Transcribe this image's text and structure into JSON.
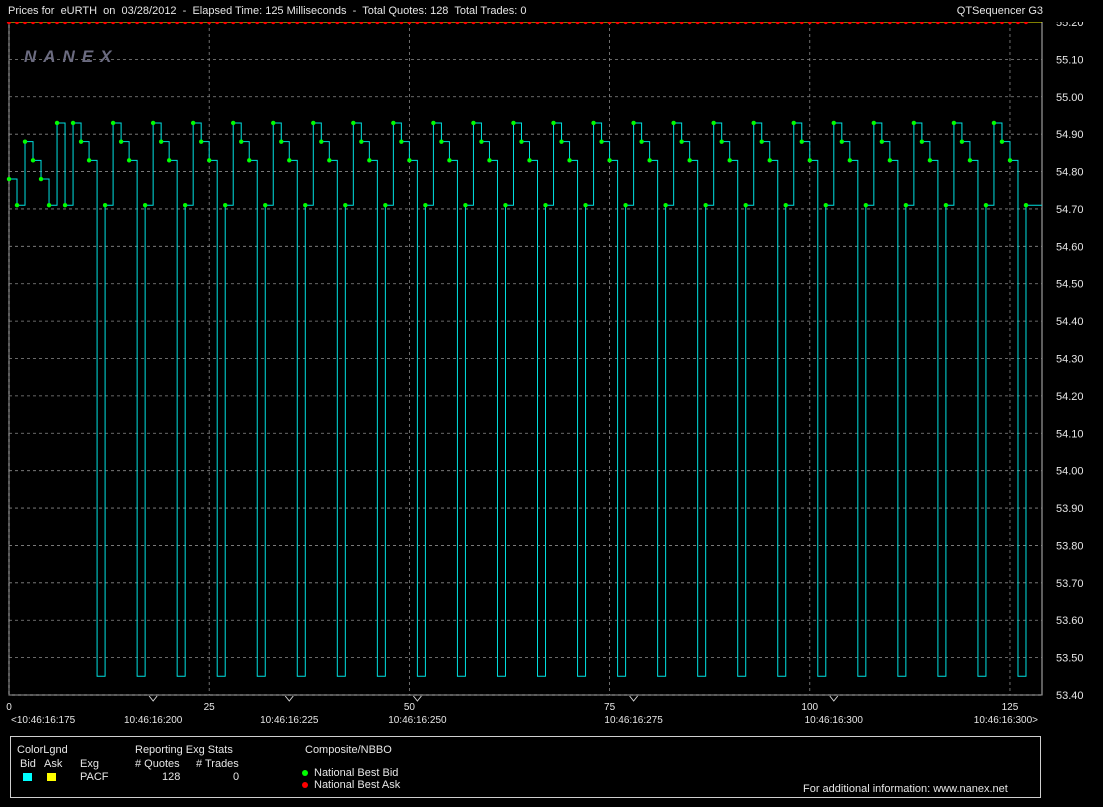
{
  "header": {
    "title": "Prices for  eURTH  on  03/28/2012  -  Elapsed Time: 125 Milliseconds  -  Total Quotes: 128  Total Trades: 0",
    "app_name": "QTSequencer G3"
  },
  "watermark": "NANEX",
  "chart_data": {
    "type": "line",
    "ylim": [
      53.4,
      55.2
    ],
    "yticks": [
      "55.20",
      "55.10",
      "55.00",
      "54.90",
      "54.80",
      "54.70",
      "54.60",
      "54.50",
      "54.40",
      "54.30",
      "54.20",
      "54.10",
      "54.00",
      "53.90",
      "53.80",
      "53.70",
      "53.60",
      "53.50",
      "53.40"
    ],
    "xlim": [
      0,
      129
    ],
    "xticks": [
      {
        "x": 0,
        "label": "0"
      },
      {
        "x": 25,
        "label": "25"
      },
      {
        "x": 50,
        "label": "50"
      },
      {
        "x": 75,
        "label": "75"
      },
      {
        "x": 100,
        "label": "100"
      },
      {
        "x": 125,
        "label": "125"
      }
    ],
    "time_labels": [
      {
        "x": 0,
        "label": "<10:46:16:175"
      },
      {
        "x": 18,
        "label": "10:46:16:200"
      },
      {
        "x": 35,
        "label": "10:46:16:225"
      },
      {
        "x": 51,
        "label": "10:46:16:250"
      },
      {
        "x": 78,
        "label": "10:46:16:275"
      },
      {
        "x": 103,
        "label": "10:46:16:300"
      },
      {
        "x": 129,
        "label": "10:46:16:300>"
      }
    ],
    "time_markers": [
      18,
      35,
      51,
      78,
      103
    ],
    "grid": true,
    "series": [
      {
        "name": "National Best Ask",
        "color": "#ff0000",
        "constant": 55.2
      },
      {
        "name": "National Best Bid",
        "color": "#00ff00",
        "cycle": [
          54.71,
          54.93,
          54.88,
          54.83,
          53.45
        ],
        "first": [
          54.78,
          54.71,
          54.88,
          54.83,
          54.78,
          54.71,
          54.93
        ]
      }
    ]
  },
  "legend": {
    "color_legend_title": "ColorLgnd",
    "bid_label": "Bid",
    "ask_label": "Ask",
    "bid_color": "#00ffff",
    "ask_color": "#ffff00",
    "exg_header": "Exg",
    "exg_value": "PACF",
    "stats_title": "Reporting Exg Stats",
    "quotes_header": "# Quotes",
    "quotes_value": "128",
    "trades_header": "# Trades",
    "trades_value": "0",
    "composite_title": "Composite/NBBO",
    "nbb_label": "National Best Bid",
    "nbo_label": "National Best Ask",
    "nbb_color": "#00ff00",
    "nbo_color": "#ff0000",
    "info_text": "For additional information: www.nanex.net"
  }
}
